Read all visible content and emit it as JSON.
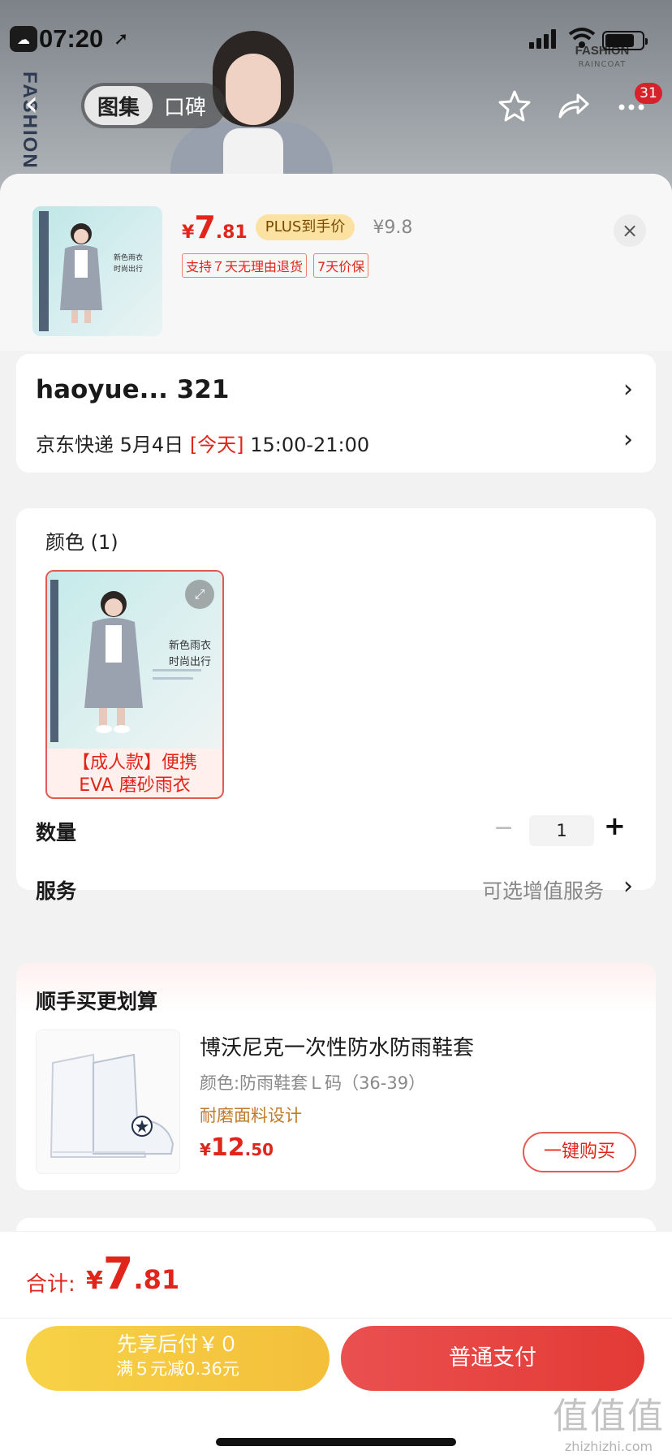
{
  "status_bar": {
    "time": "07:20"
  },
  "header": {
    "brand_vertical": "FASHION",
    "brand_logo": "FASHION",
    "brand_logo_sub": "RAINCOAT",
    "tabs": [
      {
        "label": "图集",
        "active": true
      },
      {
        "label": "口碑",
        "active": false
      }
    ],
    "cart_badge": "31",
    "icons": [
      "back-icon",
      "star-icon",
      "share-icon",
      "more-icon"
    ]
  },
  "sku_sheet": {
    "price": {
      "currency": "¥",
      "integer": "7",
      "decimal": ".81"
    },
    "plus_label": "PLUS到手价",
    "original_price": "¥9.8",
    "tags": [
      "支持７天无理由退货",
      "7天价保"
    ],
    "close_icon": "×"
  },
  "address": {
    "name": "haoyue...  321",
    "delivery_prefix": "京东快递 5月4日",
    "delivery_today": "[今天]",
    "delivery_time": "15:00-21:00"
  },
  "options": {
    "color_title": "颜色 (1)",
    "colors": [
      {
        "name_line1": "【成人款】便携",
        "name_line2": "EVA 磨砂雨衣",
        "selected": true,
        "image_text1": "新色雨衣",
        "image_text2": "时尚出行"
      }
    ],
    "quantity_label": "数量",
    "quantity_value": "1",
    "minus": "−",
    "plus": "+",
    "service_label": "服务",
    "service_value": "可选增值服务"
  },
  "bundle": {
    "title": "顺手买更划算",
    "item": {
      "name": "博沃尼克一次性防水防雨鞋套",
      "spec": "颜色:防雨鞋套Ｌ码（36-39）",
      "feature": "耐磨面料设计",
      "price": {
        "currency": "¥",
        "integer": "12",
        "decimal": ".50"
      },
      "buy_label": "一键购买"
    }
  },
  "footer": {
    "total_label": "合计:",
    "total_price": {
      "currency": "¥",
      "integer": "7",
      "decimal": ".81"
    },
    "paylater_line1": "先享后付￥０",
    "paylater_line2": "满５元减0.36元",
    "pay_label": "普通支付"
  },
  "watermark": {
    "mark": "值值值",
    "text": "zhizhizhi.com"
  },
  "colors": {
    "accent_red": "#e1251b",
    "plus_gold": "#fbe2a3",
    "paylater_yellow": "#f4bf3a"
  }
}
